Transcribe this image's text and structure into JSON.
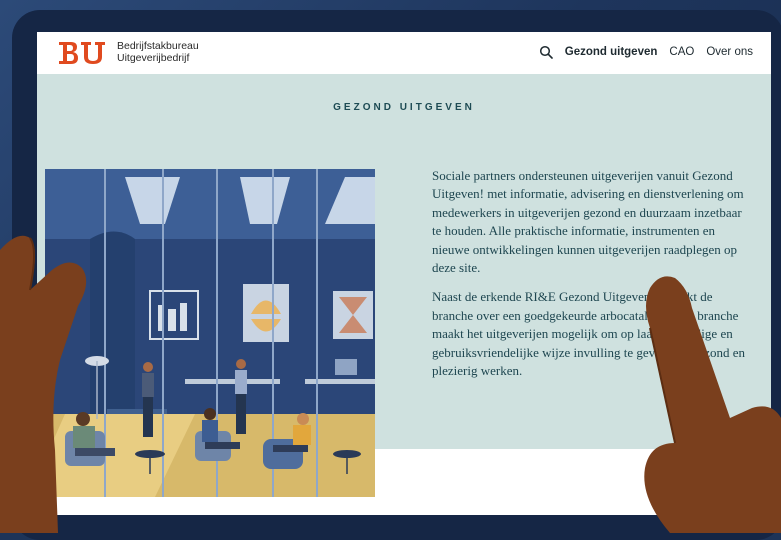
{
  "brand": {
    "logo_text": "BU",
    "line1": "Bedrijfstakbureau",
    "line2": "Uitgeverijbedrijf"
  },
  "nav": {
    "items": [
      {
        "label": "Gezond uitgeven",
        "active": true
      },
      {
        "label": "CAO",
        "active": false
      },
      {
        "label": "Over ons",
        "active": false
      }
    ]
  },
  "hero": {
    "kicker": "GEZOND UITGEVEN",
    "paragraphs": [
      "Sociale partners ondersteunen uitgeverijen vanuit Gezond Uitgeven! met informatie, advisering en dienstverlening om medewerkers in uitgeverijen gezond en duurzaam inzetbaar te houden. Alle praktische informatie, instrumenten en nieuwe ontwikkelingen kunnen uitgeverijen raadplegen op deze site.",
      "Naast de erkende RI&E Gezond Uitgeven beschikt de branche over een goedgekeurde arbocatalogus. De branche maakt het uitgeverijen mogelijk om op laagdrempelige en gebruiksvriendelijke wijze invulling te geven aan gezond en plezierig werken."
    ]
  },
  "colors": {
    "accent": "#e04a1f",
    "section_bg": "#cfe1df",
    "text": "#1e4650"
  },
  "icons": {
    "search": "search-icon"
  }
}
